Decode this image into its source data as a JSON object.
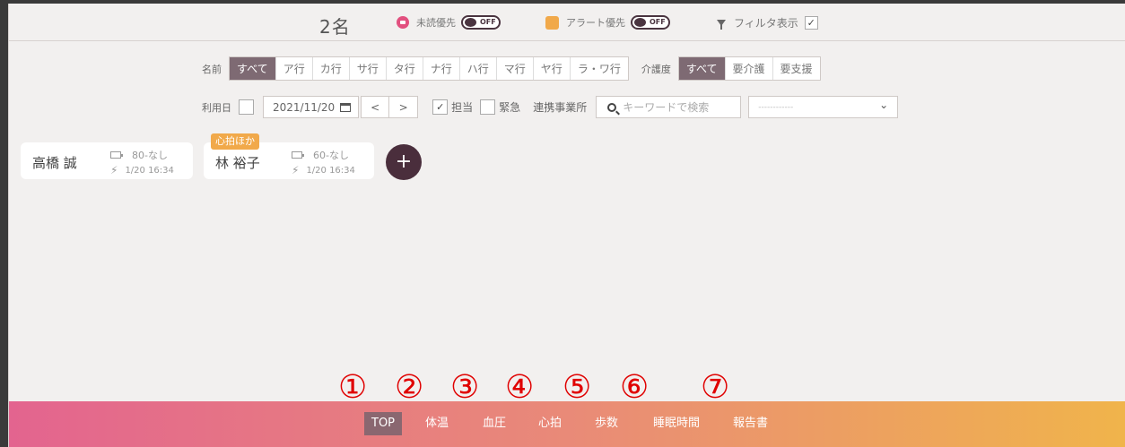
{
  "header": {
    "count": "2名",
    "unread_label": "未読優先",
    "unread_toggle": "OFF",
    "alert_label": "アラート優先",
    "alert_toggle": "OFF",
    "filter_label": "フィルタ表示",
    "filter_checked": "✓"
  },
  "filters": {
    "name_label": "名前",
    "name_options": [
      "すべて",
      "ア行",
      "カ行",
      "サ行",
      "タ行",
      "ナ行",
      "ハ行",
      "マ行",
      "ヤ行",
      "ラ・ワ行"
    ],
    "care_label": "介護度",
    "care_options": [
      "すべて",
      "要介護",
      "要支援"
    ],
    "use_date_label": "利用日",
    "date_value": "2021/11/20",
    "prev": "<",
    "next": ">",
    "charge_check": "✓",
    "charge_label": "担当",
    "urgent_label": "緊急",
    "partner_label": "連携事業所",
    "search_placeholder": "キーワードで検索",
    "select_value": "------------",
    "select_chevron": "⌄"
  },
  "cards": [
    {
      "name": "高橋 誠",
      "battery": "80-なし",
      "time": "1/20 16:34"
    },
    {
      "name": "林 裕子",
      "battery": "60-なし",
      "time": "1/20 16:34",
      "tag": "心拍ほか"
    }
  ],
  "add_label": "+",
  "annotations": [
    "①",
    "②",
    "③",
    "④",
    "⑤",
    "⑥",
    "⑦"
  ],
  "nav": [
    "TOP",
    "体温",
    "血圧",
    "心拍",
    "歩数",
    "睡眠時間",
    "報告書"
  ],
  "colors": {
    "accent": "#7e6a73",
    "alert": "#f1a94a",
    "unread": "#e2507f",
    "annotation": "#e00000"
  }
}
